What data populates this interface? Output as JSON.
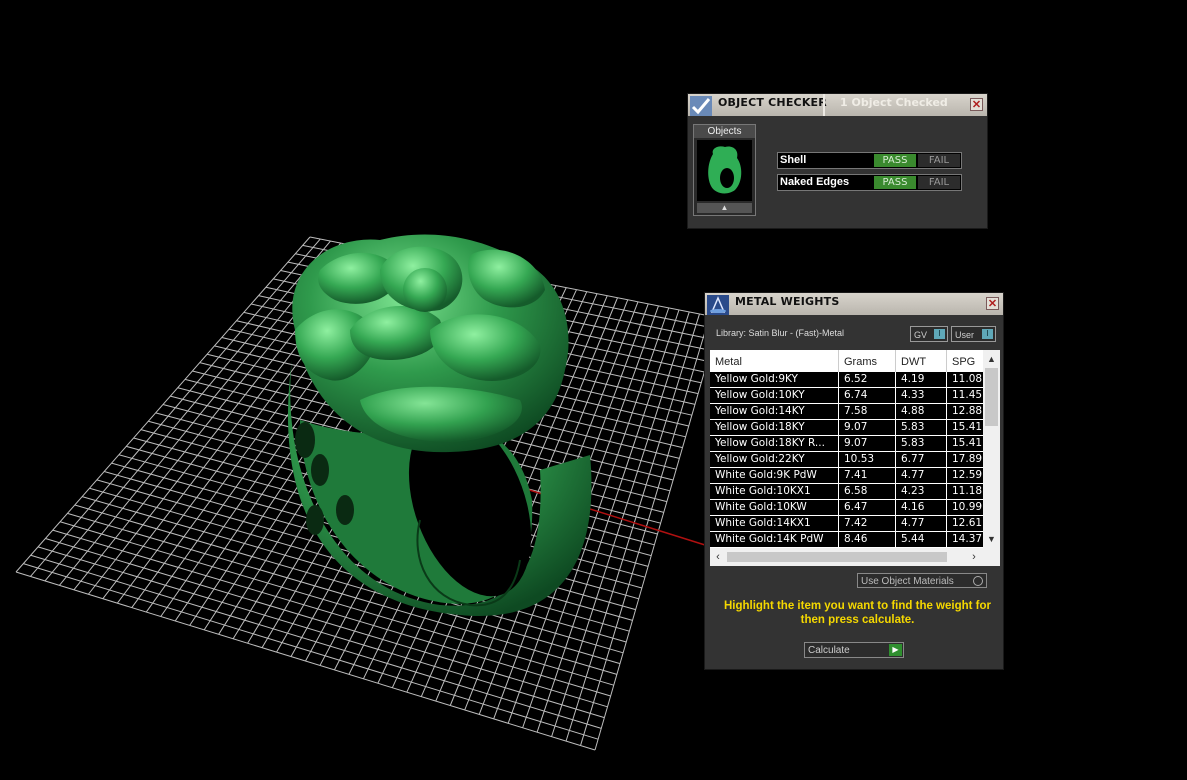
{
  "viewport": {
    "model": "ring",
    "model_color": "#2f9a4c",
    "grid_color": "#d0d0d0"
  },
  "object_checker": {
    "title": "OBJECT CHECKER",
    "count_text": "1  Object Checked",
    "close_icon": "close-icon",
    "objects_label": "Objects",
    "checks": [
      {
        "label": "Shell",
        "pass": "PASS",
        "fail": "FAIL",
        "result": "PASS"
      },
      {
        "label": "Naked Edges",
        "pass": "PASS",
        "fail": "FAIL",
        "result": "PASS"
      }
    ]
  },
  "metal_weights": {
    "title": "METAL WEIGHTS",
    "library": "Library: Satin Blur - (Fast)-Metal",
    "toggle_gv": "GV",
    "toggle_user": "User",
    "toggle_knob": "I",
    "columns": [
      "Metal",
      "Grams",
      "DWT",
      "SPG"
    ],
    "rows": [
      [
        "Yellow Gold:9KY",
        "6.52",
        "4.19",
        "11.08"
      ],
      [
        "Yellow Gold:10KY",
        "6.74",
        "4.33",
        "11.45"
      ],
      [
        "Yellow Gold:14KY",
        "7.58",
        "4.88",
        "12.88"
      ],
      [
        "Yellow Gold:18KY",
        "9.07",
        "5.83",
        "15.41"
      ],
      [
        "Yellow Gold:18KY R...",
        "9.07",
        "5.83",
        "15.41"
      ],
      [
        "Yellow Gold:22KY",
        "10.53",
        "6.77",
        "17.89"
      ],
      [
        "White Gold:9K PdW",
        "7.41",
        "4.77",
        "12.59"
      ],
      [
        "White Gold:10KX1",
        "6.58",
        "4.23",
        "11.18"
      ],
      [
        "White Gold:10KW",
        "6.47",
        "4.16",
        "10.99"
      ],
      [
        "White Gold:14KX1",
        "7.42",
        "4.77",
        "12.61"
      ],
      [
        "White Gold:14K PdW",
        "8.46",
        "5.44",
        "14.37"
      ]
    ],
    "use_object_materials": "Use Object Materials",
    "hint": "Highlight the item you want to find the weight for then press calculate.",
    "calculate": "Calculate"
  }
}
